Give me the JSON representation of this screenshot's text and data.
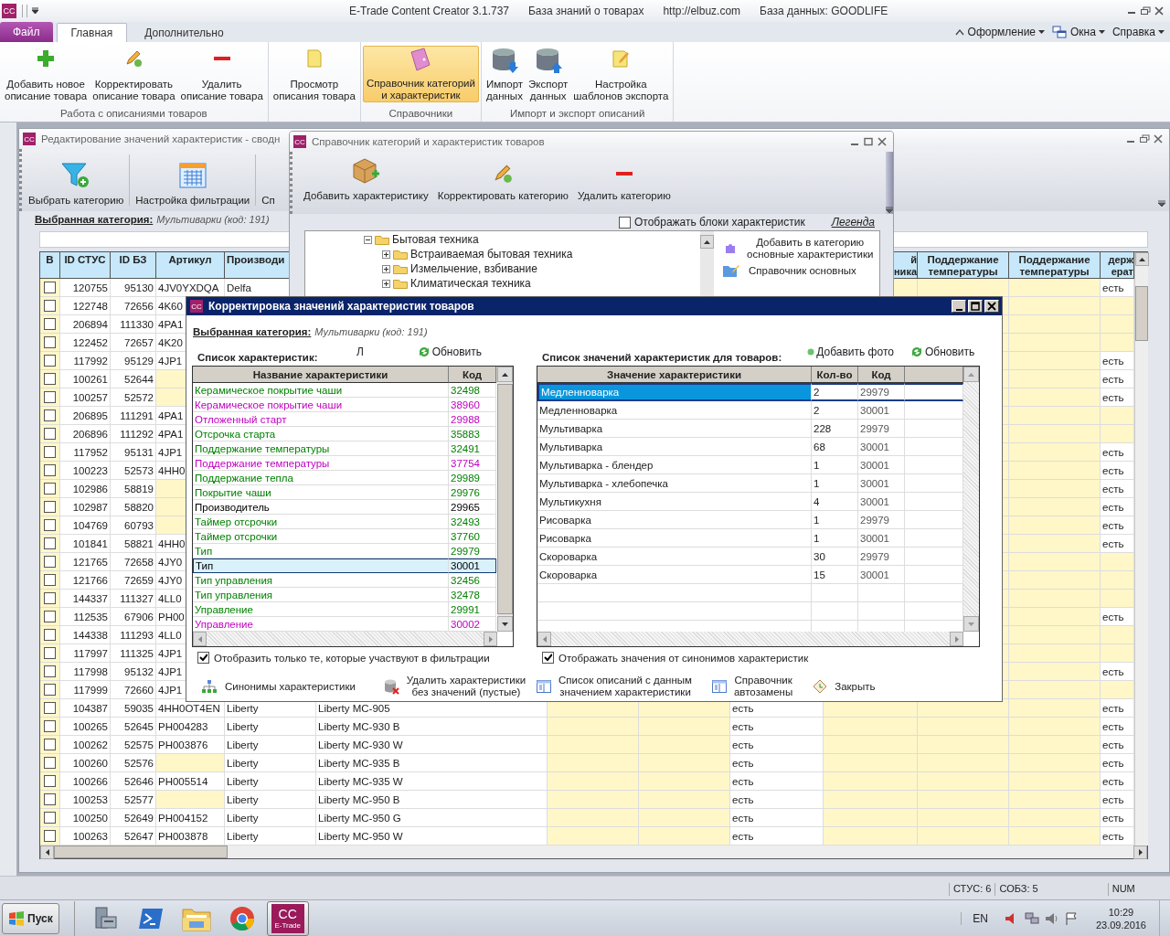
{
  "app": {
    "logo": "CC",
    "title": "E-Trade Content Creator 3.1.737",
    "knowledge_base": "База знаний о товарах",
    "url": "http://elbuz.com",
    "database": "База данных: GOODLIFE"
  },
  "ribbon_tabs": [
    {
      "label": "Файл",
      "kind": "file",
      "selected": false
    },
    {
      "label": "Главная",
      "kind": "tab",
      "selected": true
    },
    {
      "label": "Дополнительно",
      "kind": "tab",
      "selected": false
    }
  ],
  "ribbon_menu": [
    "Оформление",
    "Окна",
    "Справка"
  ],
  "ribbon_groups": [
    {
      "label": "Работа с описаниями товаров",
      "buttons": [
        {
          "label": "Добавить новое\nописание товара",
          "selected": false
        },
        {
          "label": "Корректировать\nописание товара",
          "selected": false
        },
        {
          "label": "Удалить\nописание товара",
          "selected": false
        }
      ]
    },
    {
      "buttons": [
        {
          "label": "Просмотр\nописания товара",
          "selected": false
        }
      ]
    },
    {
      "label": "Справочники",
      "buttons": [
        {
          "label": "Справочник категорий\nи характеристик",
          "selected": true
        }
      ]
    },
    {
      "label": "Импорт и экспорт описаний",
      "buttons": [
        {
          "label": "Импорт\nданных",
          "selected": false
        },
        {
          "label": "Экспорт\nданных",
          "selected": false
        },
        {
          "label": "Настройка\nшаблонов экспорта",
          "selected": false
        }
      ]
    }
  ],
  "main_window": {
    "logo": "CC",
    "title": "Редактирование значений характеристик - сводн",
    "toolbar": [
      "Выбрать категорию",
      "Настройка фильтрации",
      "Сп"
    ],
    "category_label": "Выбранная категория:",
    "category_value": "Мультиварки (код: 191)",
    "table": {
      "headers": {
        "col_1": "В",
        "col_2": "ID СТУС",
        "col_3": "ID БЗ",
        "col_4": "Артикул",
        "col_5": "Производи",
        "col_10": "й\nника",
        "col_11": "Поддержание температуры",
        "col_12": "Поддержание температуры",
        "col_13": "держ\nерат"
      },
      "rows": [
        {
          "checked": false,
          "col_2": "120755",
          "col_3": "95130",
          "col_4": "4JV0YXDQA",
          "col_5": "Delfa",
          "col_13": "есть"
        },
        {
          "checked": false,
          "col_2": "122748",
          "col_3": "72656",
          "col_4": "4K60"
        },
        {
          "checked": false,
          "col_2": "206894",
          "col_3": "111330",
          "col_4": "4PA1"
        },
        {
          "checked": false,
          "col_2": "122452",
          "col_3": "72657",
          "col_4": "4K20"
        },
        {
          "checked": false,
          "col_2": "117992",
          "col_3": "95129",
          "col_4": "4JP1",
          "col_13": "есть"
        },
        {
          "checked": false,
          "col_2": "100261",
          "col_3": "52644",
          "col_13": "есть"
        },
        {
          "checked": false,
          "col_2": "100257",
          "col_3": "52572",
          "col_13": "есть"
        },
        {
          "checked": false,
          "col_2": "206895",
          "col_3": "111291",
          "col_4": "4PA1"
        },
        {
          "checked": false,
          "col_2": "206896",
          "col_3": "111292",
          "col_4": "4PA1"
        },
        {
          "checked": false,
          "col_2": "117952",
          "col_3": "95131",
          "col_4": "4JP1",
          "col_13": "есть"
        },
        {
          "checked": false,
          "col_2": "100223",
          "col_3": "52573",
          "col_4": "4HH0",
          "col_13": "есть"
        },
        {
          "checked": false,
          "col_2": "102986",
          "col_3": "58819",
          "col_13": "есть"
        },
        {
          "checked": false,
          "col_2": "102987",
          "col_3": "58820",
          "col_13": "есть"
        },
        {
          "checked": false,
          "col_2": "104769",
          "col_3": "60793",
          "col_13": "есть"
        },
        {
          "checked": false,
          "col_2": "101841",
          "col_3": "58821",
          "col_4": "4HH0",
          "col_13": "есть"
        },
        {
          "checked": false,
          "col_2": "121765",
          "col_3": "72658",
          "col_4": "4JY0"
        },
        {
          "checked": false,
          "col_2": "121766",
          "col_3": "72659",
          "col_4": "4JY0"
        },
        {
          "checked": false,
          "col_2": "144337",
          "col_3": "111327",
          "col_4": "4LL0"
        },
        {
          "checked": false,
          "col_2": "112535",
          "col_3": "67906",
          "col_4": "PH00",
          "col_13": "есть"
        },
        {
          "checked": false,
          "col_2": "144338",
          "col_3": "111293",
          "col_4": "4LL0"
        },
        {
          "checked": false,
          "col_2": "117997",
          "col_3": "111325",
          "col_4": "4JP1"
        },
        {
          "checked": false,
          "col_2": "117998",
          "col_3": "95132",
          "col_4": "4JP1",
          "col_13": "есть"
        },
        {
          "checked": false,
          "col_2": "117999",
          "col_3": "72660",
          "col_4": "4JP1"
        },
        {
          "checked": false,
          "col_2": "104387",
          "col_3": "59035",
          "col_4": "4HH0OT4EN",
          "col_5": "Liberty",
          "col_6": "Liberty MC-905",
          "col_9": "есть",
          "col_13": "есть"
        },
        {
          "checked": false,
          "col_2": "100265",
          "col_3": "52645",
          "col_4": "PH004283",
          "col_5": "Liberty",
          "col_6": "Liberty MC-930 B",
          "col_9": "есть",
          "col_13": "есть"
        },
        {
          "checked": false,
          "col_2": "100262",
          "col_3": "52575",
          "col_4": "PH003876",
          "col_5": "Liberty",
          "col_6": "Liberty MC-930 W",
          "col_9": "есть",
          "col_13": "есть"
        },
        {
          "checked": false,
          "col_2": "100260",
          "col_3": "52576",
          "col_5": "Liberty",
          "col_6": "Liberty MC-935 B",
          "col_9": "есть",
          "col_13": "есть"
        },
        {
          "checked": false,
          "col_2": "100266",
          "col_3": "52646",
          "col_4": "PH005514",
          "col_5": "Liberty",
          "col_6": "Liberty MC-935 W",
          "col_9": "есть",
          "col_13": "есть"
        },
        {
          "checked": false,
          "col_2": "100253",
          "col_3": "52577",
          "col_5": "Liberty",
          "col_6": "Liberty MC-950 B",
          "col_9": "есть",
          "col_13": "есть"
        },
        {
          "checked": false,
          "col_2": "100250",
          "col_3": "52649",
          "col_4": "PH004152",
          "col_5": "Liberty",
          "col_6": "Liberty MC-950 G",
          "col_9": "есть",
          "col_13": "есть"
        },
        {
          "checked": false,
          "col_2": "100263",
          "col_3": "52647",
          "col_4": "PH003878",
          "col_5": "Liberty",
          "col_6": "Liberty MC-950 W",
          "col_9": "есть",
          "col_13": "есть"
        }
      ]
    }
  },
  "catalog_window": {
    "logo": "CC",
    "title": "Справочник категорий и характеристик товаров",
    "toolbar": [
      "Добавить характеристику",
      "Корректировать категорию",
      "Удалить категорию"
    ],
    "show_blocks": {
      "label": "Отображать блоки характеристик",
      "checked": false
    },
    "legend": "Легенда",
    "tree": [
      {
        "label": "Бытовая техника",
        "expanded": true,
        "children": [
          {
            "label": "Встраиваемая бытовая техника",
            "expanded": false
          },
          {
            "label": "Измельчение, взбивание",
            "expanded": false
          },
          {
            "label": "Климатическая техника",
            "expanded": false
          }
        ]
      }
    ],
    "actions": [
      "Добавить в категорию\nосновные характеристики",
      "Справочник основных"
    ]
  },
  "dialog": {
    "logo": "CC",
    "title": "Корректировка значений характеристик товаров",
    "category_label": "Выбранная категория:",
    "category_value": "Мультиварки (код: 191)",
    "characteristics": {
      "title": "Список характеристик:",
      "letter": "Л",
      "refresh": "Обновить",
      "columns": [
        "Название характеристики",
        "Код"
      ],
      "rows": [
        {
          "name": "Керамическое покрытие чаши",
          "code": "32498",
          "color": "#008000",
          "selected": false
        },
        {
          "name": "Керамическое покрытие чаши",
          "code": "38960",
          "color": "#c000c0",
          "selected": false
        },
        {
          "name": "Отложенный старт",
          "code": "29988",
          "color": "#c000c0",
          "selected": false
        },
        {
          "name": "Отсрочка старта",
          "code": "35883",
          "color": "#008000",
          "selected": false
        },
        {
          "name": "Поддержание температуры",
          "code": "32491",
          "color": "#008000",
          "selected": false
        },
        {
          "name": "Поддержание температуры",
          "code": "37754",
          "color": "#c000c0",
          "selected": false
        },
        {
          "name": "Поддержание тепла",
          "code": "29989",
          "color": "#008000",
          "selected": false
        },
        {
          "name": "Покрытие чаши",
          "code": "29976",
          "color": "#008000",
          "selected": false
        },
        {
          "name": "Производитель",
          "code": "29965",
          "color": "#000000",
          "selected": false
        },
        {
          "name": "Таймер отсрочки",
          "code": "32493",
          "color": "#008000",
          "selected": false
        },
        {
          "name": "Таймер отсрочки",
          "code": "37760",
          "color": "#008000",
          "selected": false
        },
        {
          "name": "Тип",
          "code": "29979",
          "color": "#008000",
          "selected": false
        },
        {
          "name": "Тип",
          "code": "30001",
          "color": "#000000",
          "selected": true
        },
        {
          "name": "Тип управления",
          "code": "32456",
          "color": "#008000",
          "selected": false
        },
        {
          "name": "Тип управления",
          "code": "32478",
          "color": "#008000",
          "selected": false
        },
        {
          "name": "Управление",
          "code": "29991",
          "color": "#008000",
          "selected": false
        },
        {
          "name": "Управление",
          "code": "30002",
          "color": "#c000c0",
          "selected": false
        }
      ],
      "filter_only": {
        "label": "Отобразить только те, которые участвуют в фильтрации",
        "checked": true
      },
      "buttons": [
        "Синонимы характеристики",
        "Удалить характеристики\nбез значений (пустые)"
      ]
    },
    "values": {
      "title": "Список значений характеристик для товаров:",
      "add_photo": "Добавить фото",
      "refresh": "Обновить",
      "columns": [
        "Значение характеристики",
        "Кол-во",
        "Код"
      ],
      "rows": [
        {
          "value": "Медленноварка",
          "count": "2",
          "code": "29979",
          "selected": true
        },
        {
          "value": "Медленноварка",
          "count": "2",
          "code": "30001",
          "selected": false
        },
        {
          "value": "Мультиварка",
          "count": "228",
          "code": "29979",
          "selected": false
        },
        {
          "value": "Мультиварка",
          "count": "68",
          "code": "30001",
          "selected": false
        },
        {
          "value": "Мультиварка - блендер",
          "count": "1",
          "code": "30001",
          "selected": false
        },
        {
          "value": "Мультиварка - хлебопечка",
          "count": "1",
          "code": "30001",
          "selected": false
        },
        {
          "value": "Мультикухня",
          "count": "4",
          "code": "30001",
          "selected": false
        },
        {
          "value": "Рисоварка",
          "count": "1",
          "code": "29979",
          "selected": false
        },
        {
          "value": "Рисоварка",
          "count": "1",
          "code": "30001",
          "selected": false
        },
        {
          "value": "Скороварка",
          "count": "30",
          "code": "29979",
          "selected": false
        },
        {
          "value": "Скороварка",
          "count": "15",
          "code": "30001",
          "selected": false
        }
      ],
      "synonyms": {
        "label": "Отображать значения от синонимов характеристик",
        "checked": true
      },
      "buttons": [
        "Список описаний с данным\nзначением характеристики",
        "Справочник\nавтозамены",
        "Закрыть"
      ]
    }
  },
  "status_bar": [
    "СТУС: 6",
    "СОБЗ: 5",
    "NUM"
  ],
  "taskbar": {
    "start": "Пуск",
    "apps": [
      {
        "kind": "server",
        "selected": false
      },
      {
        "kind": "shell",
        "selected": false
      },
      {
        "kind": "folder",
        "selected": false
      },
      {
        "kind": "browser",
        "selected": false
      },
      {
        "kind": "app",
        "logo": "CC",
        "caption": "E-Trade",
        "selected": true
      }
    ],
    "language": "EN",
    "time": "10:29",
    "date": "23.09.2016"
  }
}
